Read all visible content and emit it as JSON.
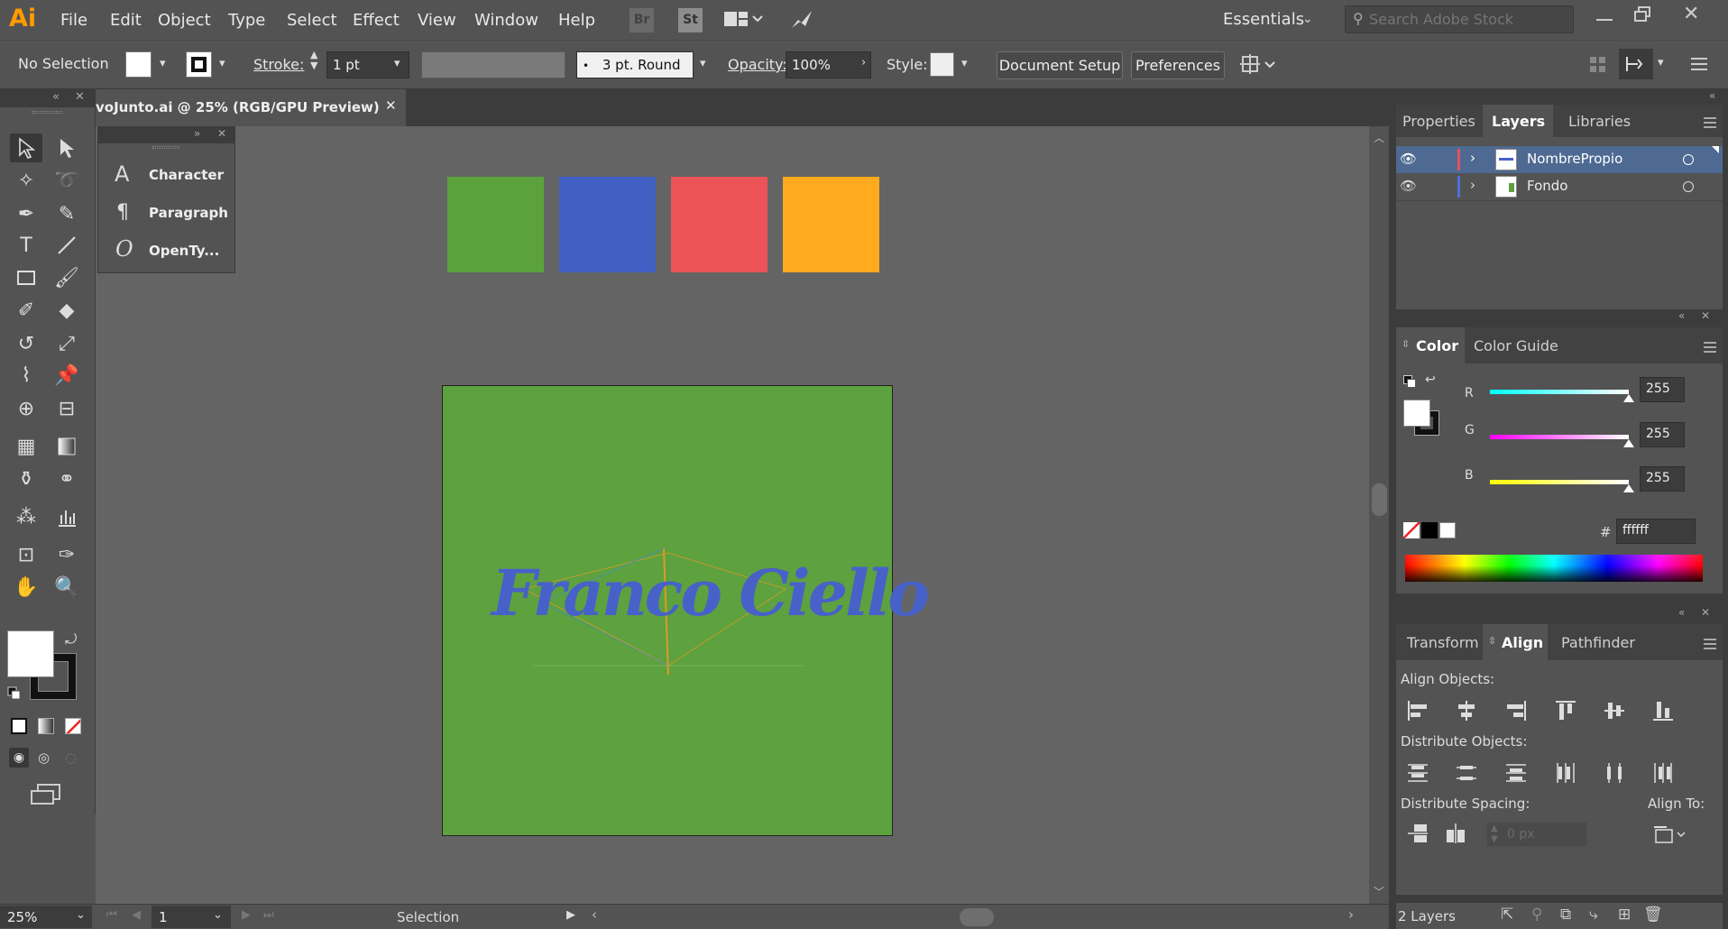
{
  "menubar": {
    "logo": "Ai",
    "items": [
      "File",
      "Edit",
      "Object",
      "Type",
      "Select",
      "Effect",
      "View",
      "Window",
      "Help"
    ],
    "bridge": "Br",
    "stock": "St",
    "workspace": "Essentials",
    "search_placeholder": "Search Adobe Stock"
  },
  "controlbar": {
    "selection": "No Selection",
    "stroke_label": "Stroke:",
    "stroke_weight": "1 pt",
    "brush": "3 pt. Round",
    "opacity_label": "Opacity:",
    "opacity_value": "100%",
    "style_label": "Style:",
    "document_setup": "Document Setup",
    "preferences": "Preferences"
  },
  "document": {
    "tab_title": "voJunto.ai @ 25% (RGB/GPU Preview)",
    "swatches": [
      "#5ba23c",
      "#425fc4",
      "#ec5357",
      "#ffaa1f"
    ],
    "artboard_color": "#5ea13f",
    "logo_text": "Franco Ciello",
    "logo_color": "#4761c9"
  },
  "char_panel": {
    "items": [
      "Character",
      "Paragraph",
      "OpenTy..."
    ]
  },
  "layers_panel": {
    "tabs": [
      "Properties",
      "Layers",
      "Libraries"
    ],
    "active_tab": "Layers",
    "layers": [
      {
        "name": "NombrePropio",
        "color": "#e8505b",
        "selected": true
      },
      {
        "name": "Fondo",
        "color": "#4f6fe0",
        "selected": false
      }
    ],
    "count": "2 Layers"
  },
  "color_panel": {
    "tabs": [
      "Color",
      "Color Guide"
    ],
    "channels": [
      {
        "label": "R",
        "value": "255",
        "gradient": "linear-gradient(to right,#00ffff,#ffffff)"
      },
      {
        "label": "G",
        "value": "255",
        "gradient": "linear-gradient(to right,#ff00ff,#ffffff)"
      },
      {
        "label": "B",
        "value": "255",
        "gradient": "linear-gradient(to right,#ffff00,#ffffff)"
      }
    ],
    "hex_label": "#",
    "hex_value": "ffffff"
  },
  "align_panel": {
    "tabs": [
      "Transform",
      "Align",
      "Pathfinder"
    ],
    "align_objects": "Align Objects:",
    "distribute_objects": "Distribute Objects:",
    "distribute_spacing": "Distribute Spacing:",
    "align_to": "Align To:",
    "spacing_value": "0 px"
  },
  "statusbar": {
    "zoom": "25%",
    "page": "1",
    "tool": "Selection"
  }
}
